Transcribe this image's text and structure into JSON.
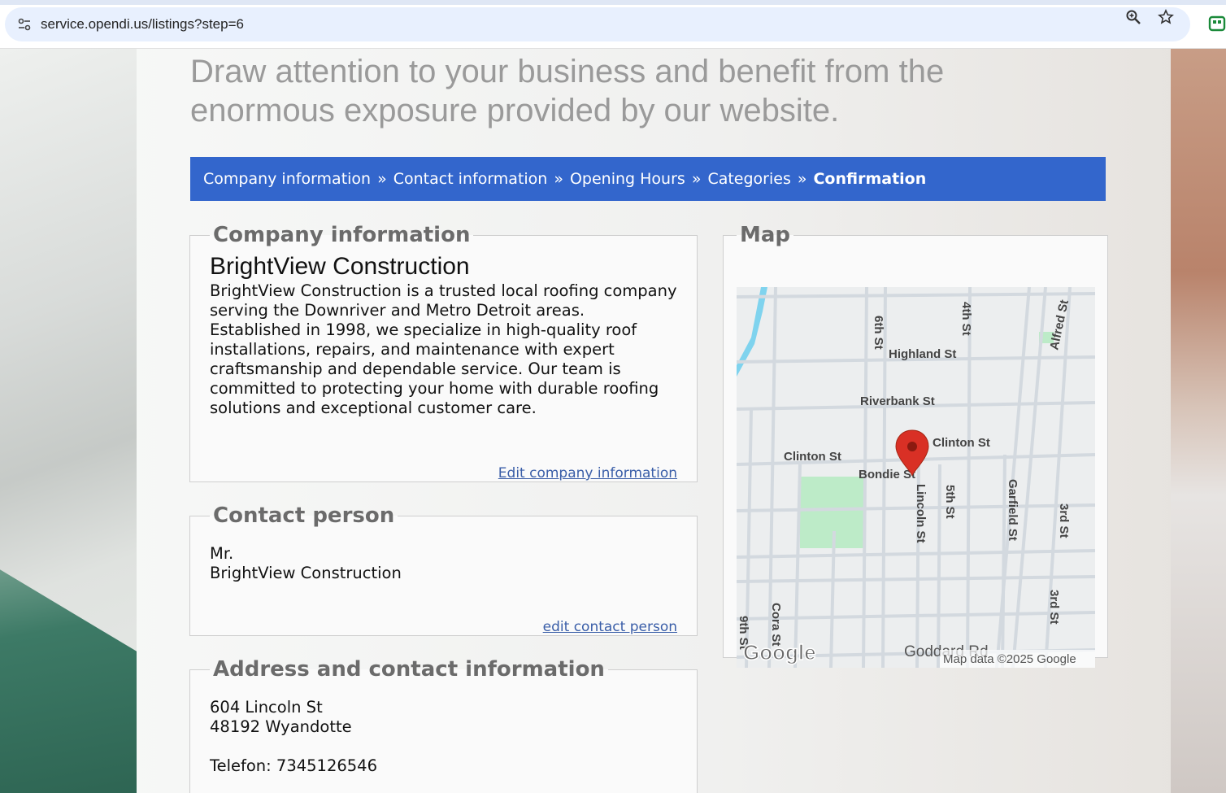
{
  "browser": {
    "url": "service.opendi.us/listings?step=6"
  },
  "headline": {
    "line1": "Draw attention to your business and benefit from the",
    "line2": "enormous exposure provided by our website."
  },
  "steps": {
    "items": [
      "Company information",
      "Contact information",
      "Opening Hours",
      "Categories"
    ],
    "separator": "»",
    "current": "Confirmation"
  },
  "company": {
    "legend": "Company information",
    "name": "BrightView Construction",
    "description": "BrightView Construction is a trusted local roofing company serving the Downriver and Metro Detroit areas. Established in 1998, we specialize in high-quality roof installations, repairs, and maintenance with expert craftsmanship and dependable service. Our team is committed to protecting your home with durable roofing solutions and exceptional customer care.",
    "edit_label": "Edit company information"
  },
  "contact": {
    "legend": "Contact person",
    "salutation": "Mr.",
    "name": "BrightView Construction",
    "edit_label": "edit contact person"
  },
  "address": {
    "legend": "Address and contact information",
    "street": "604 Lincoln St",
    "city": "48192 Wyandotte",
    "phone": "Telefon: 7345126546"
  },
  "map": {
    "legend": "Map",
    "streets": {
      "sixth": "6th St",
      "fourth": "4th St",
      "alfred": "Alfred St",
      "highland": "Highland St",
      "riverbank": "Riverbank St",
      "clinton_right": "Clinton St",
      "clinton_left": "Clinton St",
      "bondie": "Bondie St",
      "lincoln": "Lincoln St",
      "fifth": "5th St",
      "garfield": "Garfield St",
      "third_a": "3rd St",
      "third_b": "3rd St",
      "cora": "Cora St",
      "ninth": "9th St",
      "goddard": "Goddard Rd"
    },
    "logo": "Google",
    "attribution": "Map data ©2025 Google",
    "colors": {
      "marker": "#d93025",
      "park": "#bdebc8",
      "water": "#7fd3ee"
    }
  }
}
